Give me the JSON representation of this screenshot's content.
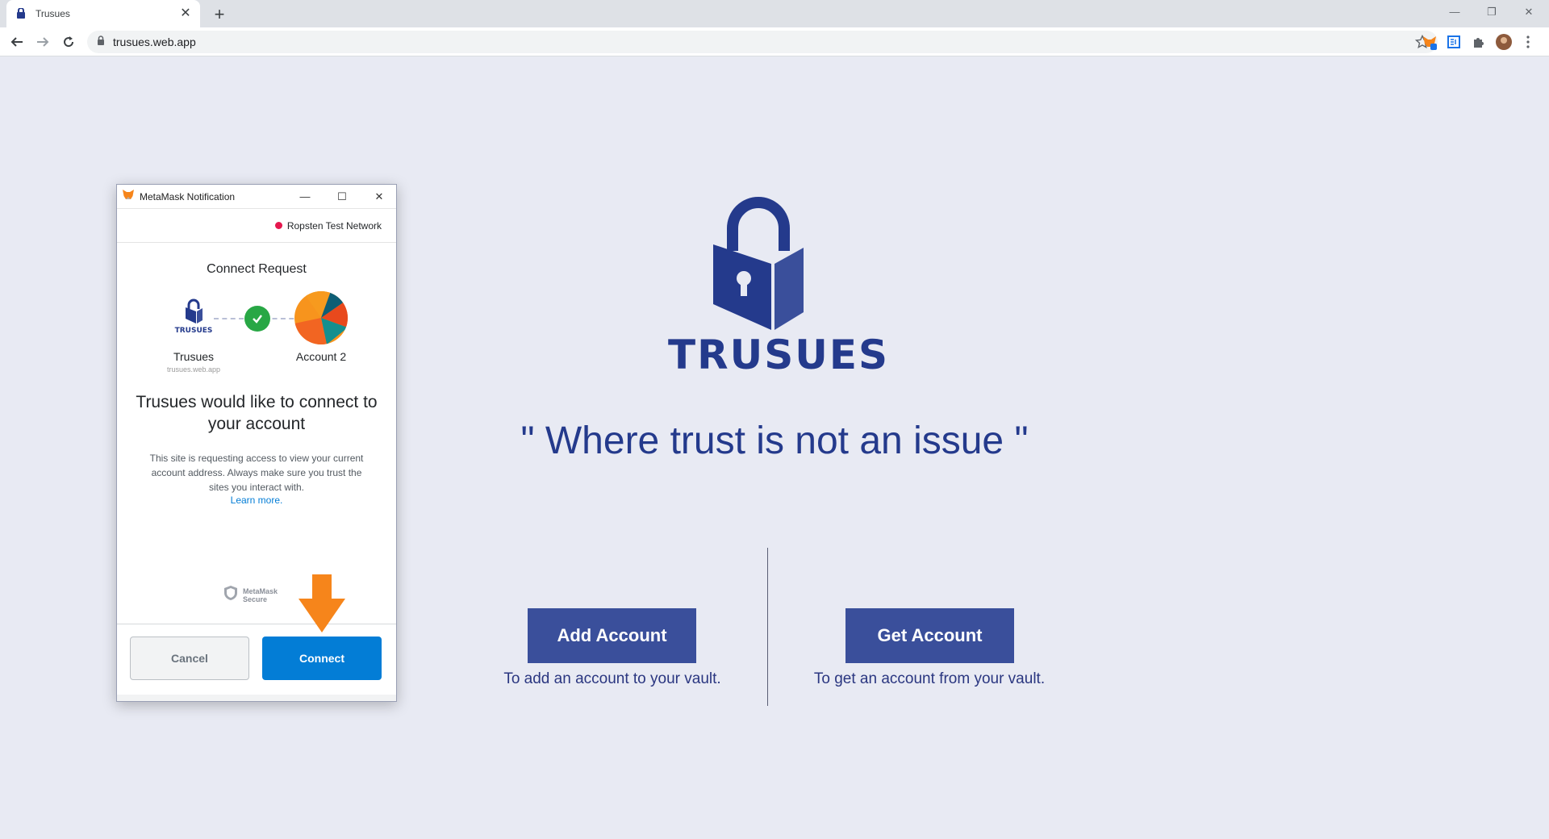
{
  "browser": {
    "tab_title": "Trusues",
    "new_tab_label": "+",
    "url": "trusues.web.app"
  },
  "page": {
    "brand": "TRUSUES",
    "tagline": "\" Where trust is not an issue \"",
    "add_button": "Add Account",
    "add_caption": "To add an account to your vault.",
    "get_button": "Get Account",
    "get_caption": "To get an account from your vault.",
    "colors": {
      "brand": "#243a8c",
      "button": "#3a4f9b",
      "background": "#e8eaf3"
    }
  },
  "metamask": {
    "window_title": "MetaMask Notification",
    "network": "Ropsten Test Network",
    "heading": "Connect Request",
    "site_logo_text": "TRUSUES",
    "site_name": "Trusues",
    "site_url": "trusues.web.app",
    "account_name": "Account 2",
    "question": "Trusues would like to connect to your account",
    "description": "This site is requesting access to view your current account address. Always make sure you trust the sites you interact with.",
    "learn_more": "Learn more.",
    "secure_line1": "MetaMask",
    "secure_line2": "Secure",
    "cancel": "Cancel",
    "connect": "Connect",
    "colors": {
      "connect": "#037dd6",
      "network_dot": "#e5184e",
      "check": "#28a745"
    }
  },
  "annotation": {
    "icon": "arrow-down-icon",
    "color": "#f6851b"
  }
}
